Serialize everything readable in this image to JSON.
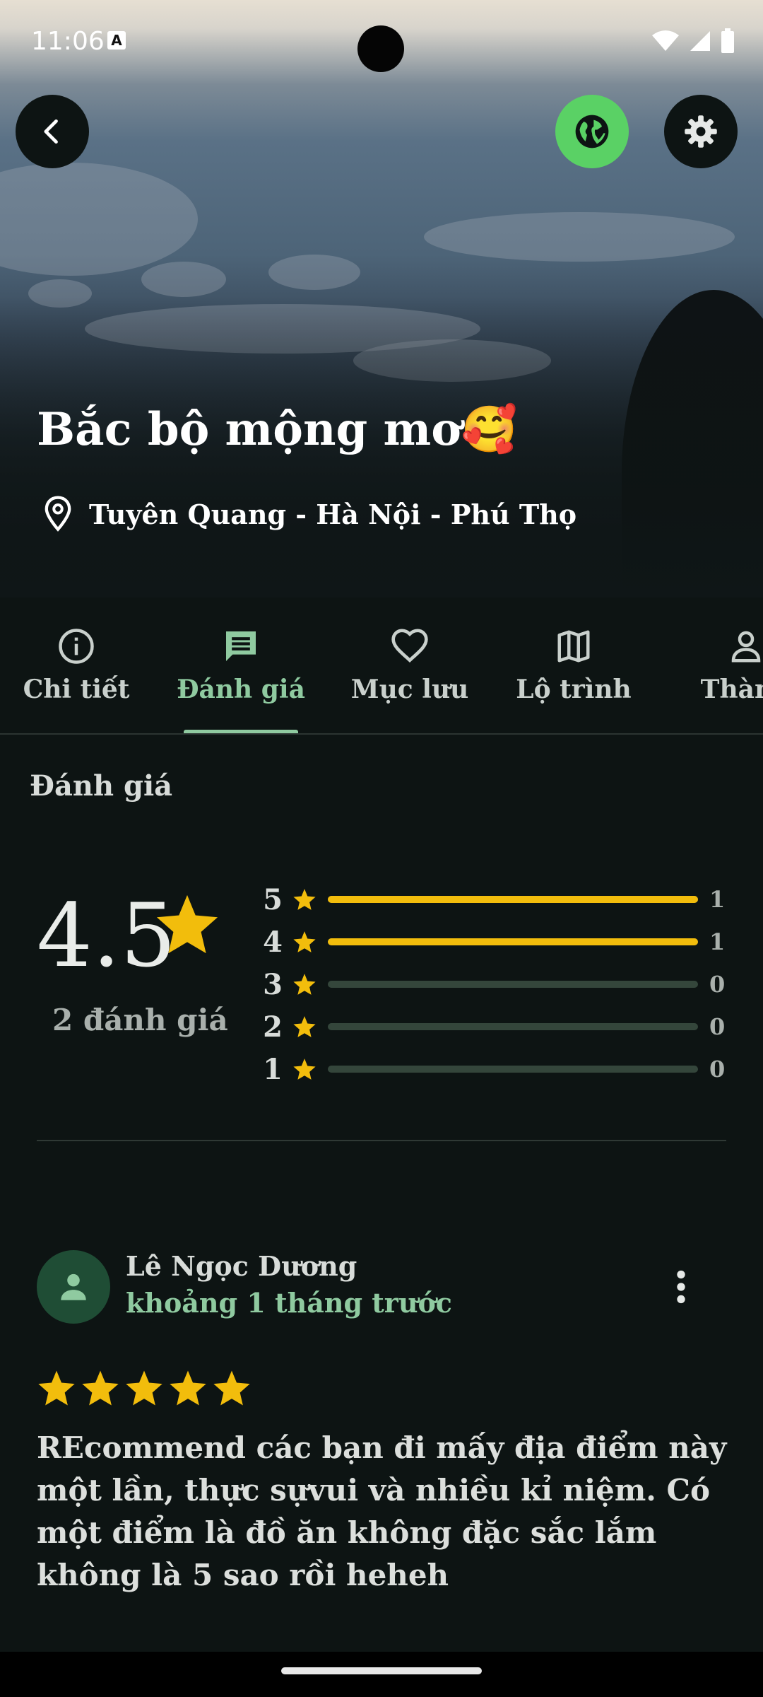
{
  "status_bar": {
    "time": "11:06",
    "indicator": "A"
  },
  "header": {
    "title": "Bắc bộ mộng mơ🥰",
    "location": "Tuyên Quang - Hà Nội - Phú Thọ",
    "icons": {
      "back": "arrow-left-icon",
      "globe": "globe-icon",
      "settings": "gear-icon",
      "location": "map-pin-icon"
    },
    "colors": {
      "globe_button": "#5ad165"
    }
  },
  "tabs": [
    {
      "label": "Chi tiết",
      "icon": "info-icon",
      "active": false
    },
    {
      "label": "Đánh giá",
      "icon": "comment-icon",
      "active": true
    },
    {
      "label": "Mục lưu",
      "icon": "heart-icon",
      "active": false
    },
    {
      "label": "Lộ trình",
      "icon": "map-icon",
      "active": false
    },
    {
      "label": "Thành",
      "icon": "person-icon",
      "active": false
    }
  ],
  "ratings": {
    "section_title": "Đánh giá",
    "average": "4.5",
    "count_text": "2 đánh giá",
    "distribution": [
      {
        "stars": "5",
        "count": "1",
        "fraction": 1
      },
      {
        "stars": "4",
        "count": "1",
        "fraction": 1
      },
      {
        "stars": "3",
        "count": "0",
        "fraction": 0
      },
      {
        "stars": "2",
        "count": "0",
        "fraction": 0
      },
      {
        "stars": "1",
        "count": "0",
        "fraction": 0
      }
    ],
    "colors": {
      "star": "#f2bd0c",
      "track": "#34463b"
    }
  },
  "review": {
    "name": "Lê Ngọc Dương",
    "time": "khoảng 1 tháng trước",
    "stars": 5,
    "text": "REcommend các bạn đi mấy  địa điểm này một lần, thực sựvui và nhiều kỉ niệm. Có một điểm là đồ ăn không đặc sắc lắm không là 5 sao rồi heheh",
    "icons": {
      "avatar": "person-icon",
      "more": "more-vertical-icon"
    },
    "colors": {
      "accent": "#8fcaa0",
      "avatar_bg": "#1f4d35"
    }
  }
}
